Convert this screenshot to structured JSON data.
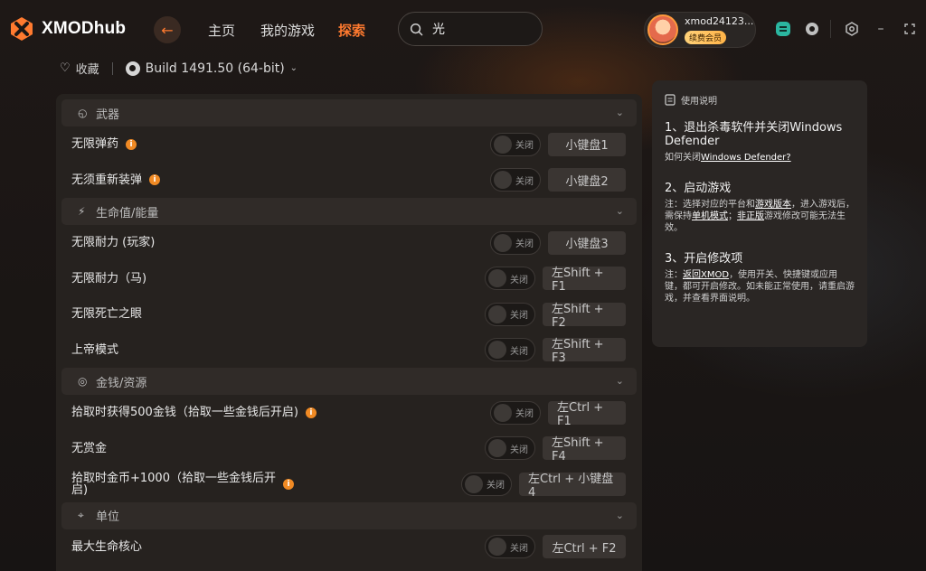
{
  "app": {
    "logo_text": "XMODhub",
    "brand_color": "#ff7a2f"
  },
  "nav": {
    "home": "主页",
    "my_games": "我的游戏",
    "explore": "探索"
  },
  "search": {
    "value": "光"
  },
  "user": {
    "name": "xmod24123...",
    "badge": "续费会员"
  },
  "subheader": {
    "favorite": "收藏",
    "build": "Build 1491.50 (64-bit)"
  },
  "sections": [
    {
      "title": "武器",
      "icon": "gun-icon",
      "rows": [
        {
          "label": "无限弹药",
          "info": true,
          "toggle": "关闭",
          "key": "小键盘1"
        },
        {
          "label": "无须重新装弹",
          "info": true,
          "toggle": "关闭",
          "key": "小键盘2"
        }
      ]
    },
    {
      "title": "生命值/能量",
      "icon": "lightning-icon",
      "rows": [
        {
          "label": "无限耐力 (玩家)",
          "info": false,
          "toggle": "关闭",
          "key": "小键盘3"
        },
        {
          "label": "无限耐力（马)",
          "info": false,
          "toggle": "关闭",
          "key": "左Shift + F1"
        },
        {
          "label": "无限死亡之眼",
          "info": false,
          "toggle": "关闭",
          "key": "左Shift + F2"
        },
        {
          "label": "上帝模式",
          "info": false,
          "toggle": "关闭",
          "key": "左Shift + F3"
        }
      ]
    },
    {
      "title": "金钱/资源",
      "icon": "money-bag-icon",
      "rows": [
        {
          "label": "拾取时获得500金钱（拾取一些金钱后开启)",
          "info": true,
          "toggle": "关闭",
          "key": "左Ctrl + F1"
        },
        {
          "label": "无赏金",
          "info": false,
          "toggle": "关闭",
          "key": "左Shift + F4"
        },
        {
          "label": "拾取时金币+1000（拾取一些金钱后开启)",
          "info": true,
          "toggle": "关闭",
          "key": "左Ctrl + 小键盘4"
        }
      ]
    },
    {
      "title": "单位",
      "icon": "target-icon",
      "rows": [
        {
          "label": "最大生命核心",
          "info": false,
          "toggle": "关闭",
          "key": "左Ctrl + F2"
        }
      ]
    }
  ],
  "help": {
    "title": "使用说明",
    "step1_title": "1、退出杀毒软件并关闭Windows Defender",
    "step1_desc_prefix": "如何关闭",
    "step1_link": "Windows Defender?",
    "step2_title": "2、启动游戏",
    "step2_desc_a": "注：选择对应的平台和",
    "step2_link1": "游戏版本",
    "step2_desc_b": "，进入游戏后，需保持",
    "step2_link2": "单机模式",
    "step2_desc_c": "；",
    "step2_link3": "非正版",
    "step2_desc_d": "游戏修改可能无法生效。",
    "step3_title": "3、开启修改项",
    "step3_desc_a": "注：",
    "step3_link": "返回XMOD",
    "step3_desc_b": "，使用开关、快捷键或应用键，都可开启修改。如未能正常使用，请重启游戏，并查看界面说明。"
  }
}
